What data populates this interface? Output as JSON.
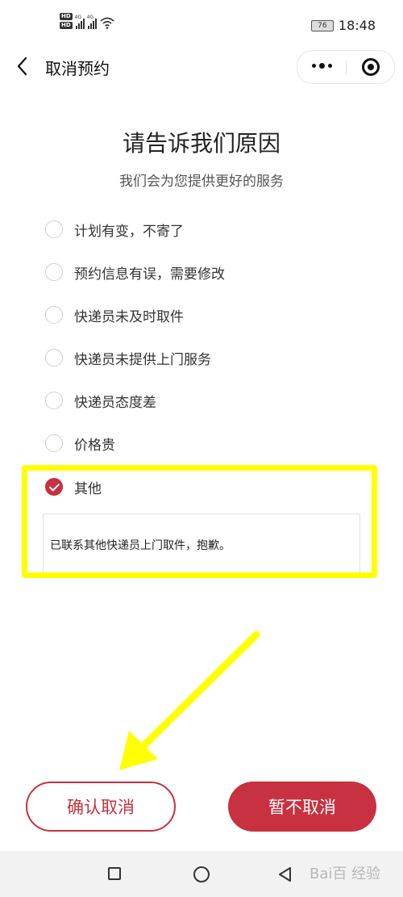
{
  "status_bar": {
    "hd_1": "HD",
    "hd_2": "HD",
    "signal_1_label": "4G",
    "signal_2_label": "4G",
    "battery": "76",
    "time": "18:48"
  },
  "nav": {
    "title": "取消预约"
  },
  "header": {
    "title": "请告诉我们原因",
    "subtitle": "我们会为您提供更好的服务"
  },
  "options": [
    {
      "label": "计划有变，不寄了",
      "checked": false
    },
    {
      "label": "预约信息有误，需要修改",
      "checked": false
    },
    {
      "label": "快递员未及时取件",
      "checked": false
    },
    {
      "label": "快递员未提供上门服务",
      "checked": false
    },
    {
      "label": "快递员态度差",
      "checked": false
    },
    {
      "label": "价格贵",
      "checked": false
    },
    {
      "label": "其他",
      "checked": true
    }
  ],
  "other_reason": {
    "value": "已联系其他快递员上门取件，抱歉。"
  },
  "buttons": {
    "confirm_cancel": "确认取消",
    "keep": "暂不取消"
  },
  "watermark": "Bai百 经验",
  "colors": {
    "accent": "#c8313f",
    "highlight": "#ffff00"
  }
}
